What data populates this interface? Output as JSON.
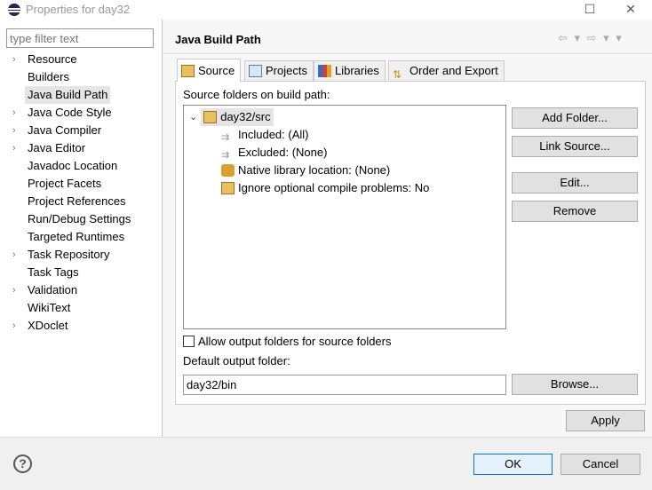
{
  "window": {
    "title": "Properties for day32",
    "minimize": "–",
    "maximize": "☐",
    "close": "✕"
  },
  "filter": {
    "placeholder": "type filter text"
  },
  "nav": [
    {
      "label": "Resource",
      "expandable": true
    },
    {
      "label": "Builders",
      "expandable": false
    },
    {
      "label": "Java Build Path",
      "expandable": false,
      "selected": true
    },
    {
      "label": "Java Code Style",
      "expandable": true
    },
    {
      "label": "Java Compiler",
      "expandable": true
    },
    {
      "label": "Java Editor",
      "expandable": true
    },
    {
      "label": "Javadoc Location",
      "expandable": false
    },
    {
      "label": "Project Facets",
      "expandable": false
    },
    {
      "label": "Project References",
      "expandable": false
    },
    {
      "label": "Run/Debug Settings",
      "expandable": false
    },
    {
      "label": "Targeted Runtimes",
      "expandable": false
    },
    {
      "label": "Task Repository",
      "expandable": true
    },
    {
      "label": "Task Tags",
      "expandable": false
    },
    {
      "label": "Validation",
      "expandable": true
    },
    {
      "label": "WikiText",
      "expandable": false
    },
    {
      "label": "XDoclet",
      "expandable": true
    }
  ],
  "page": {
    "title": "Java Build Path",
    "nav_arrows": "⇦ ▾ ⇨ ▾ ▾"
  },
  "tabs": [
    {
      "label": "Source",
      "active": true
    },
    {
      "label": "Projects"
    },
    {
      "label": "Libraries"
    },
    {
      "label": "Order and Export"
    }
  ],
  "source": {
    "label": "Source folders on build path:",
    "root": "day32/src",
    "children": [
      "Included: (All)",
      "Excluded: (None)",
      "Native library location: (None)",
      "Ignore optional compile problems: No"
    ],
    "buttons": {
      "add": "Add Folder...",
      "link": "Link Source...",
      "edit": "Edit...",
      "remove": "Remove"
    },
    "allow_output": "Allow output folders for source folders",
    "allow_checked": false,
    "default_output_label": "Default output folder:",
    "default_output_value": "day32/bin",
    "browse": "Browse..."
  },
  "footer": {
    "apply": "Apply",
    "ok": "OK",
    "cancel": "Cancel",
    "help": "?"
  }
}
